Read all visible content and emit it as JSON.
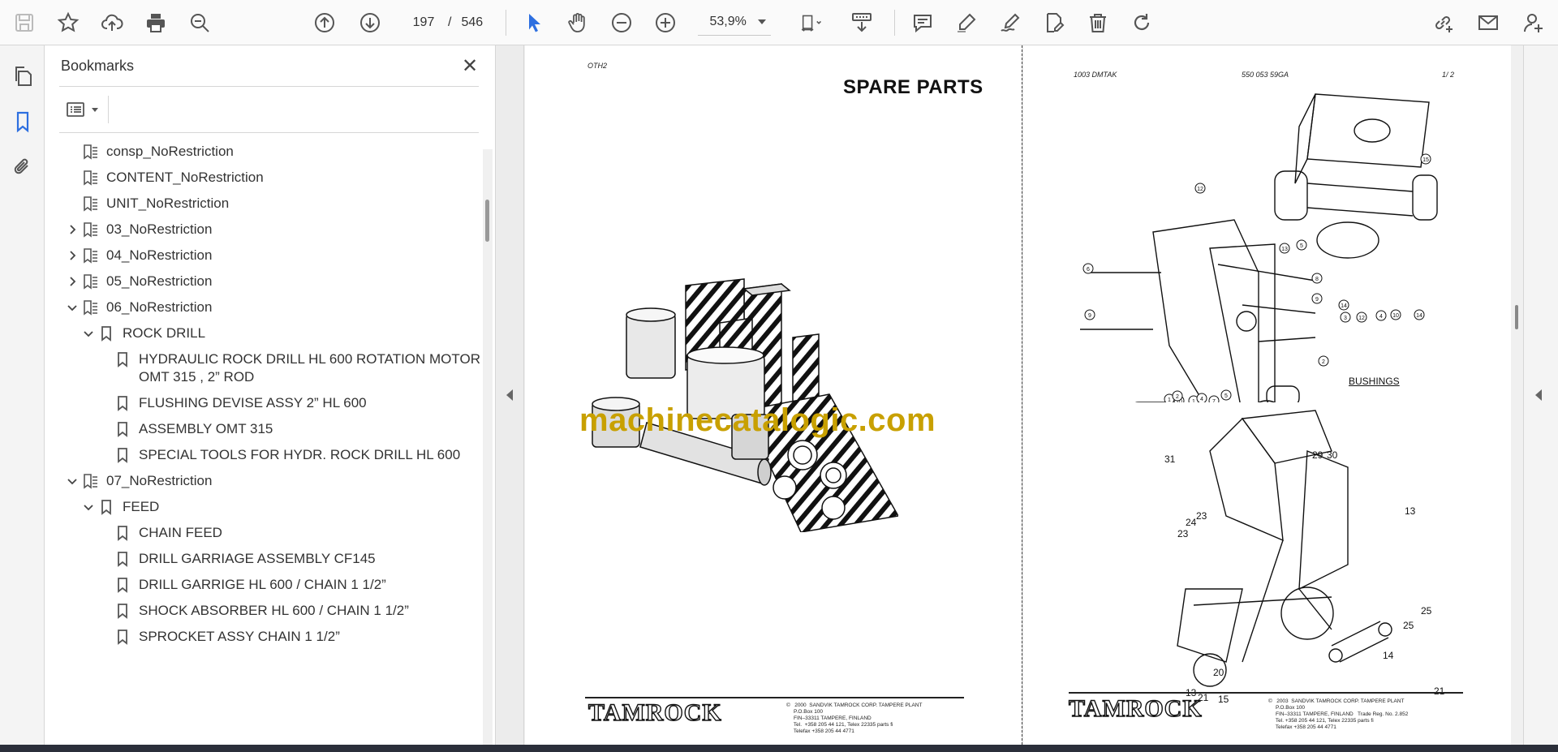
{
  "toolbar": {
    "page_current": "197",
    "page_separator": "/",
    "page_total": "546",
    "zoom": "53,9%"
  },
  "panel": {
    "title": "Bookmarks"
  },
  "bookmarks": [
    {
      "label": "consp_NoRestriction",
      "level": 0,
      "expand": "none",
      "icon": "tagged-bookmark-icon"
    },
    {
      "label": "CONTENT_NoRestriction",
      "level": 0,
      "expand": "none",
      "icon": "tagged-bookmark-icon"
    },
    {
      "label": "UNIT_NoRestriction",
      "level": 0,
      "expand": "none",
      "icon": "tagged-bookmark-icon"
    },
    {
      "label": "03_NoRestriction",
      "level": 0,
      "expand": "collapsed",
      "icon": "tagged-bookmark-icon"
    },
    {
      "label": "04_NoRestriction",
      "level": 0,
      "expand": "collapsed",
      "icon": "tagged-bookmark-icon"
    },
    {
      "label": "05_NoRestriction",
      "level": 0,
      "expand": "collapsed",
      "icon": "tagged-bookmark-icon"
    },
    {
      "label": "06_NoRestriction",
      "level": 0,
      "expand": "expanded",
      "icon": "tagged-bookmark-icon"
    },
    {
      "label": "ROCK DRILL",
      "level": 1,
      "expand": "expanded",
      "icon": "bookmark-icon"
    },
    {
      "label": "HYDRAULIC ROCK DRILL HL 600 ROTATION MOTOR OMT 315 , 2” ROD",
      "level": 2,
      "expand": "none",
      "icon": "bookmark-icon"
    },
    {
      "label": "FLUSHING DEVISE ASSY 2” HL 600",
      "level": 2,
      "expand": "none",
      "icon": "bookmark-icon"
    },
    {
      "label": "ASSEMBLY OMT 315",
      "level": 2,
      "expand": "none",
      "icon": "bookmark-icon"
    },
    {
      "label": "SPECIAL TOOLS FOR HYDR. ROCK DRILL HL 600",
      "level": 2,
      "expand": "none",
      "icon": "bookmark-icon"
    },
    {
      "label": "07_NoRestriction",
      "level": 0,
      "expand": "expanded",
      "icon": "tagged-bookmark-icon"
    },
    {
      "label": "FEED",
      "level": 1,
      "expand": "expanded",
      "icon": "bookmark-icon"
    },
    {
      "label": "CHAIN FEED",
      "level": 2,
      "expand": "none",
      "icon": "bookmark-icon"
    },
    {
      "label": "DRILL GARRIAGE ASSEMBLY CF145",
      "level": 2,
      "expand": "none",
      "icon": "bookmark-icon"
    },
    {
      "label": "DRILL GARRIGE HL 600 / CHAIN 1 1/2”",
      "level": 2,
      "expand": "none",
      "icon": "bookmark-icon"
    },
    {
      "label": "SHOCK ABSORBER HL 600 / CHAIN 1 1/2”",
      "level": 2,
      "expand": "none",
      "icon": "bookmark-icon"
    },
    {
      "label": "SPROCKET ASSY CHAIN 1 1/2”",
      "level": 2,
      "expand": "none",
      "icon": "bookmark-icon"
    }
  ],
  "document": {
    "left_page": {
      "header_code": "OTH2",
      "title": "SPARE PARTS",
      "watermark": "machinecatalogic.com",
      "brand": "TAMROCK",
      "footer_text": "©   2000  SANDVIK TAMROCK CORP. TAMPERE PLANT\n     P.O.Box 100\n     FIN–33311 TAMPERE, FINLAND\n     Tel.  +358 205 44 121, Telex 22335 parts fi\n     Telefax +358 205 44 4771"
    },
    "right_page": {
      "header_left": "1003   DMTAK",
      "header_mid": "550 053 59GA",
      "header_right": "1/  2",
      "section_label": "BUSHINGS",
      "brand": "TAMROCK",
      "footer_text": "©   2003  SANDVIK TAMROCK CORP. TAMPERE PLANT\n     P.O.Box 100\n     FIN–33311 TAMPERE, FINLAND   Trade Reg. No. 2.852\n     Tel. +358 205 44 121, Telex 22335 parts fi\n     Telefax +358 205 44 4771",
      "callouts_upper": [
        "15",
        "12",
        "13",
        "14",
        "3",
        "12",
        "4",
        "10",
        "14",
        "5",
        "8",
        "9",
        "2",
        "1",
        "10",
        "16",
        "1",
        "6",
        "9",
        "2",
        "1",
        "4",
        "7",
        "5"
      ],
      "callouts_lower": [
        "31",
        "29",
        "30",
        "13",
        "23",
        "24",
        "23",
        "25",
        "25",
        "14",
        "20",
        "13",
        "21",
        "15",
        "21"
      ]
    }
  },
  "colors": {
    "watermark": "#c8a000",
    "bookmark_active": "#2d6fe0"
  }
}
